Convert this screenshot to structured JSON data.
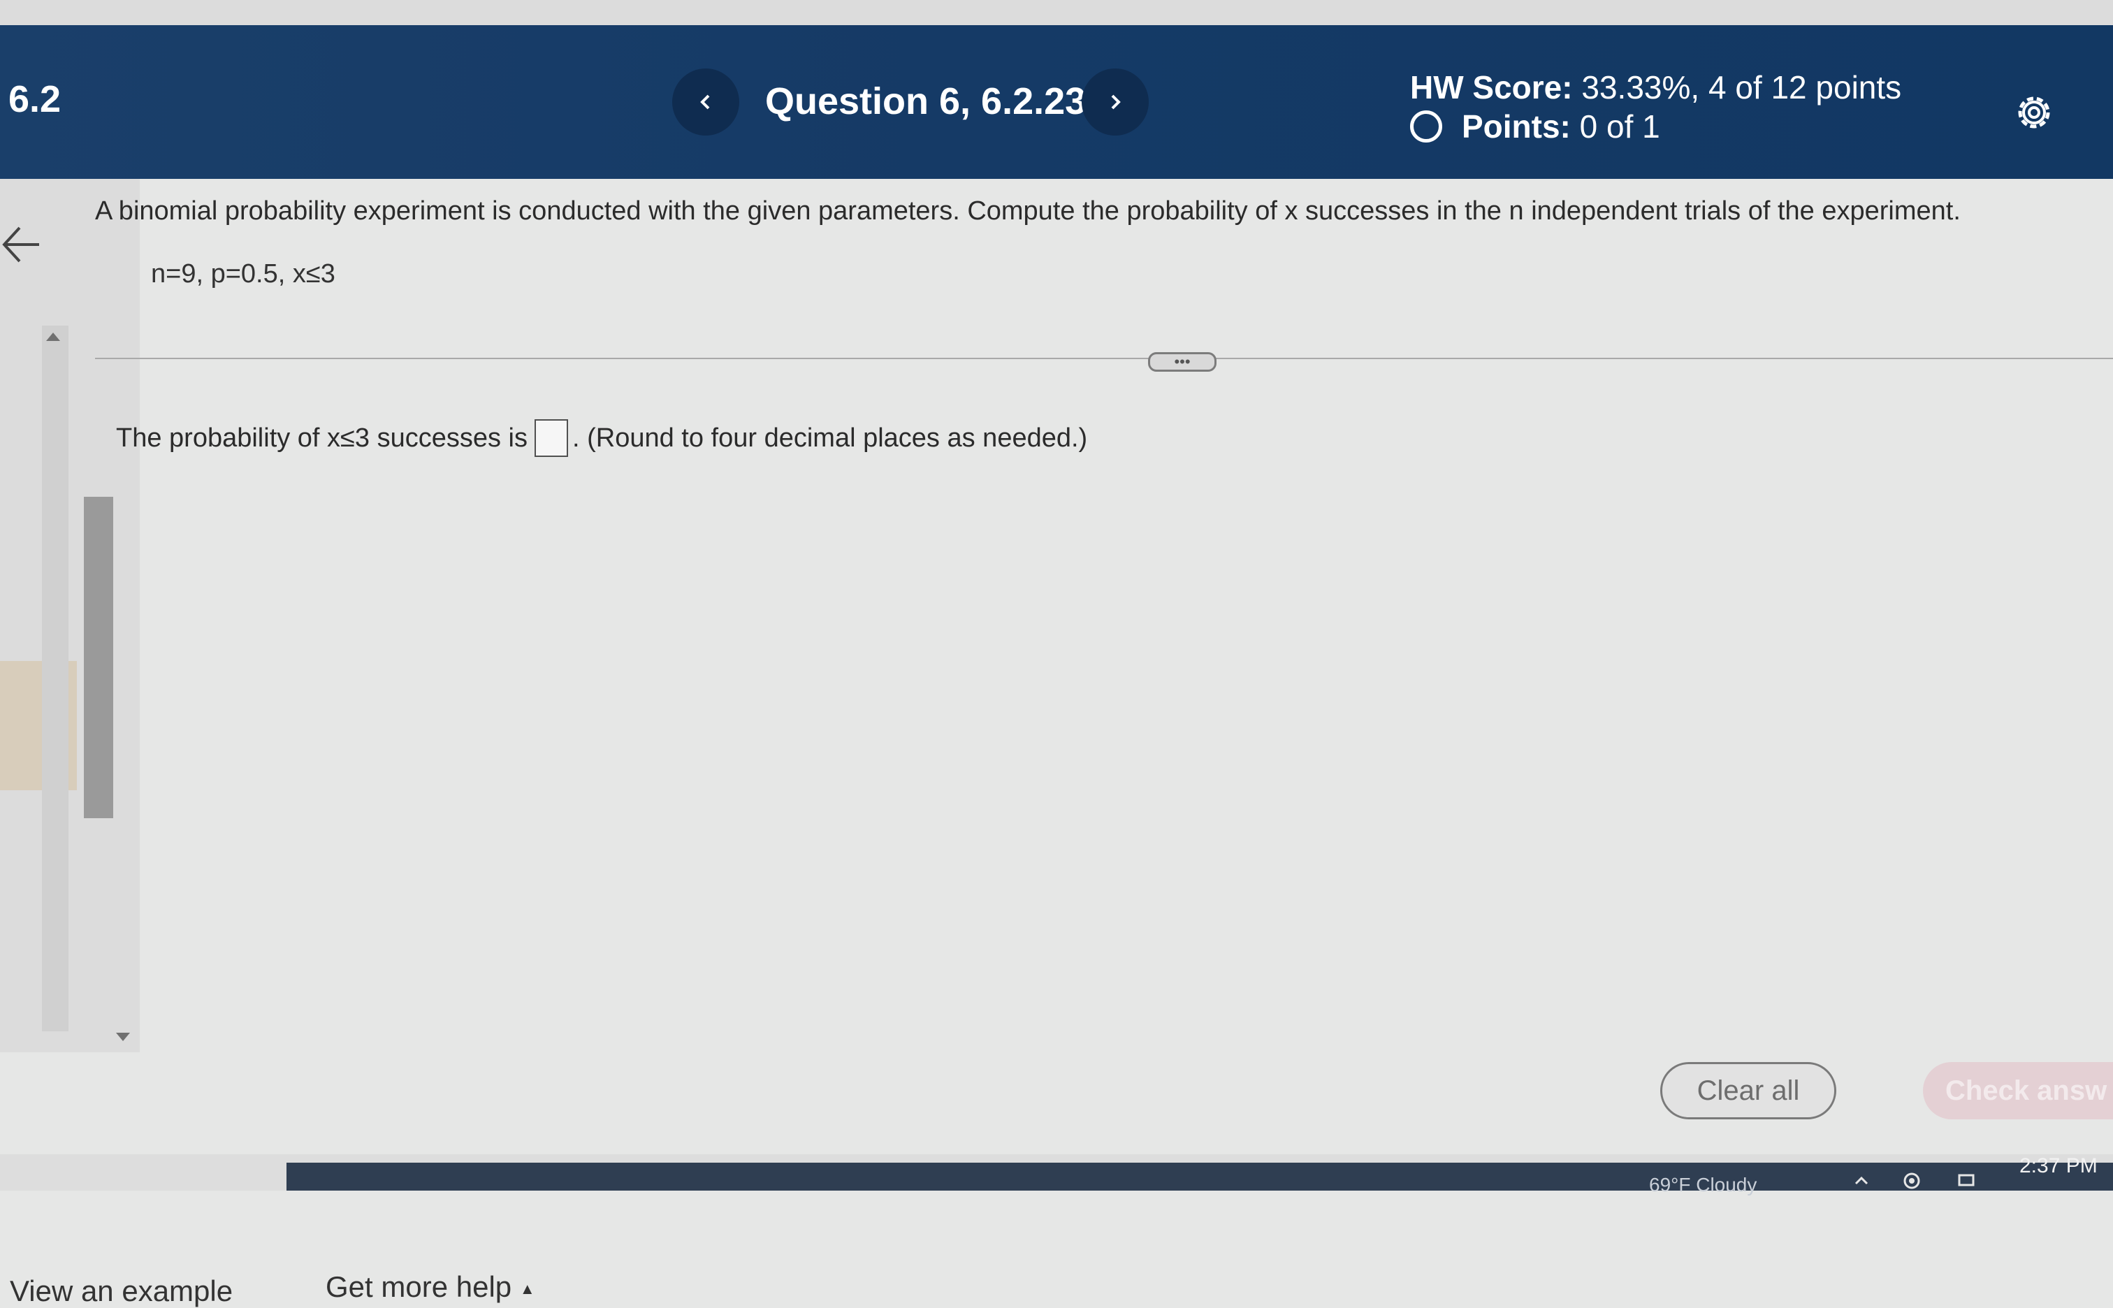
{
  "header": {
    "section": "6.2",
    "question_title": "Question 6, 6.2.23",
    "hw_score_label": "HW Score:",
    "hw_score_value": "33.33%, 4 of 12 points",
    "points_label": "Points:",
    "points_value": "0 of 1"
  },
  "problem": {
    "statement": "A binomial probability experiment is conducted with the given parameters. Compute the probability of x successes in the n independent trials of the experiment.",
    "parameters": "n=9, p=0.5, x≤3"
  },
  "answer": {
    "prefix": "The probability of x≤3 successes is",
    "input_value": "",
    "suffix": ". (Round to four decimal places as needed.)"
  },
  "footer": {
    "view_example": "View an example",
    "get_more_help": "Get more help",
    "clear_all": "Clear all",
    "check_answer": "Check answ"
  },
  "taskbar": {
    "weather": "69°F Cloudy",
    "time": "2:37 PM"
  },
  "colors": {
    "header_bg": "#1a3f6a",
    "nav_button_bg": "#0f2c50",
    "page_bg": "#e6e7e6",
    "check_answer_bg": "#e4d0d4"
  },
  "icons": {
    "prev": "chevron-left-icon",
    "next": "chevron-right-icon",
    "settings": "gear-icon",
    "back": "arrow-left-icon",
    "help_caret": "caret-up-icon"
  }
}
